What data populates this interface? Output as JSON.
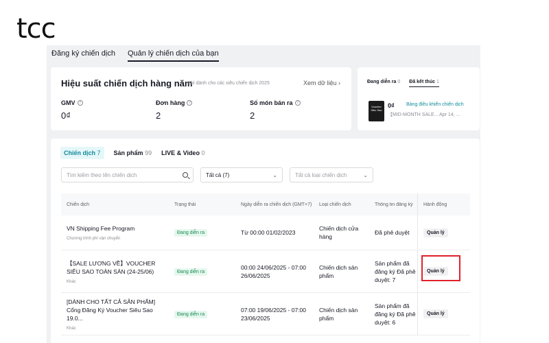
{
  "logo": "tcc",
  "top_tabs": [
    "Đăng ký chiến dịch",
    "Quản lý chiến dịch của bạn"
  ],
  "perf": {
    "title": "Hiệu suất chiến dịch hàng năm",
    "subtitle": "Chỉ dành cho các siêu chiến dịch 2025",
    "link": "Xem dữ liệu",
    "stats": [
      {
        "label": "GMV",
        "value": "0₫"
      },
      {
        "label": "Đơn hàng",
        "value": "2"
      },
      {
        "label": "Số món bán ra",
        "value": "2"
      }
    ]
  },
  "side": {
    "tabs": [
      {
        "label": "Đang diễn ra",
        "count": "0"
      },
      {
        "label": "Đã kết thúc",
        "count": "1"
      }
    ],
    "gmv": "0₫",
    "link": "Bảng điều khiển chiến dịch",
    "name": "【MID-MONTH SALE...   Apr 14, ...",
    "thumb_text": "Voucher Siêu Sao"
  },
  "sub_tabs": [
    {
      "label": "Chiến dịch",
      "count": "7"
    },
    {
      "label": "Sản phẩm",
      "count": "99"
    },
    {
      "label": "LIVE & Video",
      "count": "0"
    }
  ],
  "filters": {
    "search_placeholder": "Tìm kiếm theo tên chiến dịch",
    "status": "Tất cả (7)",
    "type_placeholder": "Tất cả loại chiến dịch"
  },
  "table": {
    "headers": [
      "Chiến dịch",
      "Trạng thái",
      "Ngày diễn ra chiến dịch (GMT+7)",
      "Loại chiến dịch",
      "Thông tin đăng ký",
      "Hành động"
    ],
    "rows": [
      {
        "name": "VN Shipping Fee Program",
        "sub": "Chương trình phí vận chuyển",
        "status": "Đang diễn ra",
        "date": "Từ 00:00 01/02/2023",
        "type": "Chiến dịch cửa hàng",
        "info": "Đã phê duyệt",
        "action": "Quản lý"
      },
      {
        "name": "【SALE LƯƠNG VỀ】VOUCHER SIÊU SAO TOÀN SÀN (24-25/06)",
        "sub": "Khác",
        "status": "Đang diễn ra",
        "date": "00:00 24/06/2025 - 07:00 26/06/2025",
        "type": "Chiến dịch sản phẩm",
        "info": "Sản phẩm đã đăng ký Đã phê duyệt: 7",
        "action": "Quản lý"
      },
      {
        "name": "[DÀNH CHO TẤT CẢ SẢN PHẨM] Cổng Đăng Ký Voucher Siêu Sao 19.0...",
        "sub": "Khác",
        "status": "Đang diễn ra",
        "date": "07:00 19/06/2025 - 07:00 23/06/2025",
        "type": "Chiến dịch sản phẩm",
        "info": "Sản phẩm đã đăng ký Đã phê duyệt: 6",
        "action": "Quản lý"
      }
    ]
  }
}
